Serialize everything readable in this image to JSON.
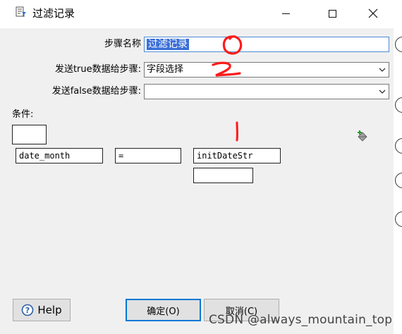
{
  "window": {
    "title": "过滤记录"
  },
  "form": {
    "step_name_label": "步骤名称",
    "step_name_value": "过滤记录",
    "true_step_label": "发送true数据给步骤:",
    "true_step_value": "字段选择",
    "false_step_label": "发送false数据给步骤:",
    "false_step_value": ""
  },
  "condition": {
    "label": "条件:",
    "left_field": "date_month",
    "operator": "=",
    "right_field": "initDateStr",
    "value_field": ""
  },
  "annotations": {
    "mark_0": "0",
    "mark_2": "2",
    "mark_1": "1"
  },
  "buttons": {
    "help": "Help",
    "ok": "确定(O)",
    "cancel": "取消(C)"
  },
  "watermark": "CSDN @always_mountain_top",
  "colors": {
    "selection": "#3a6fd8",
    "annotation_red": "#ff1a1a",
    "dialog_bg": "#f0f0f0",
    "default_button_border": "#0078d7"
  }
}
